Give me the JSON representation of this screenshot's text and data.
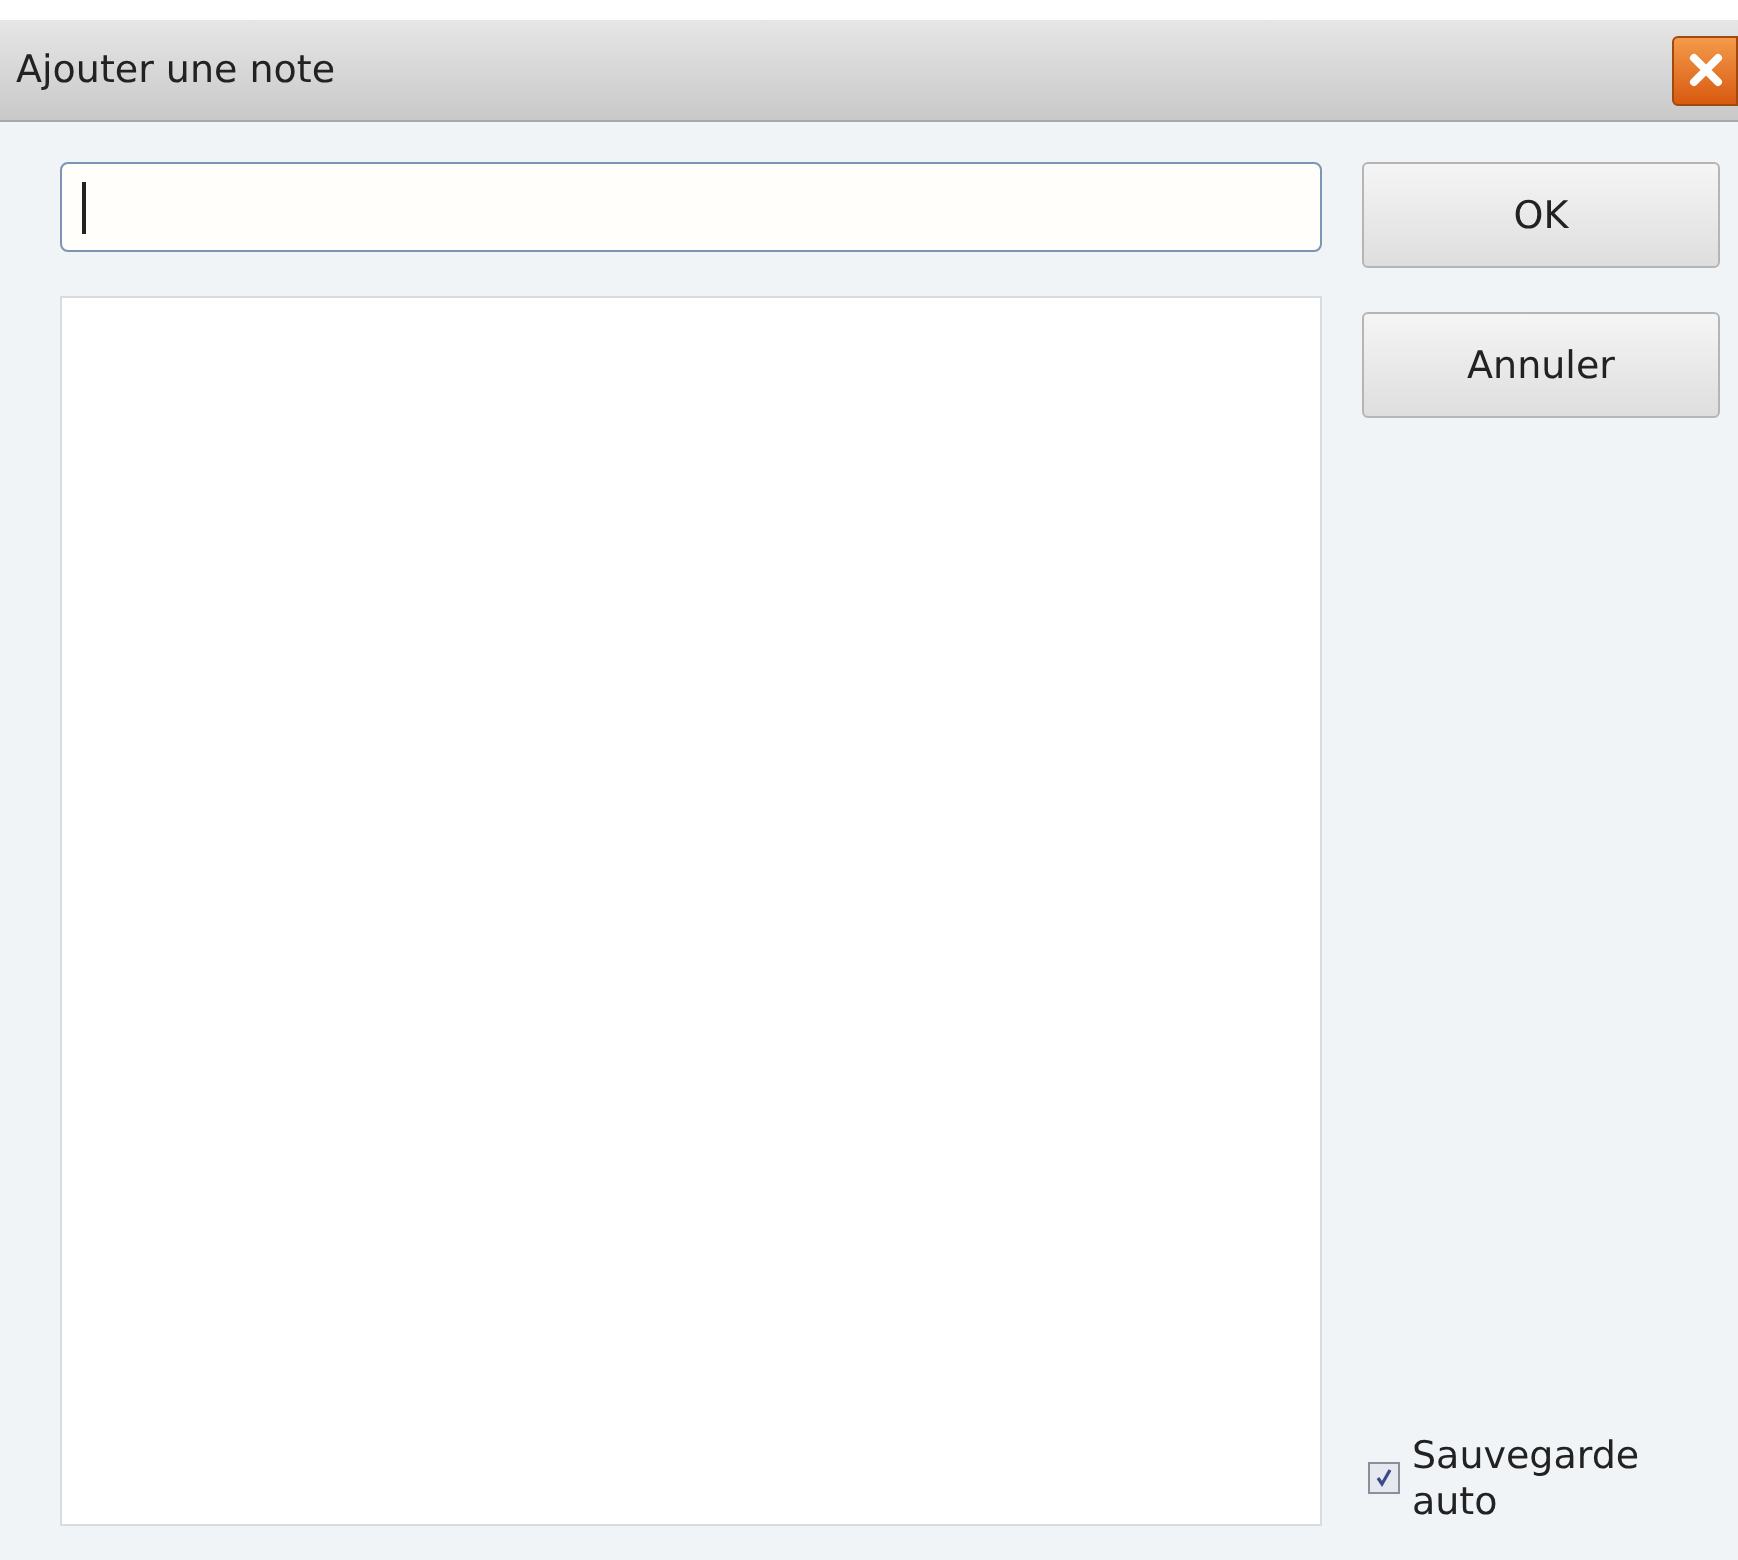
{
  "window": {
    "title": "Ajouter une note"
  },
  "buttons": [
    {
      "label": "OK"
    },
    {
      "label": "Annuler"
    }
  ],
  "auto_save": {
    "label": "Sauvegarde auto",
    "checked": true
  }
}
